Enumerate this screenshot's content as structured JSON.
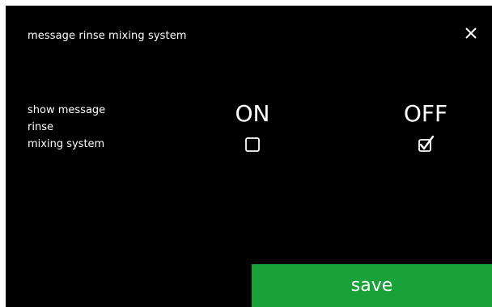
{
  "header": {
    "title": "message rinse mixing system",
    "close_icon": "close-icon"
  },
  "setting": {
    "label_lines": [
      "show message",
      "rinse",
      "mixing system"
    ],
    "options": [
      {
        "label": "ON",
        "checked": false
      },
      {
        "label": "OFF",
        "checked": true
      }
    ]
  },
  "footer": {
    "save_label": "save"
  },
  "colors": {
    "background": "#000000",
    "text": "#ffffff",
    "save_button": "#1aa23a"
  }
}
